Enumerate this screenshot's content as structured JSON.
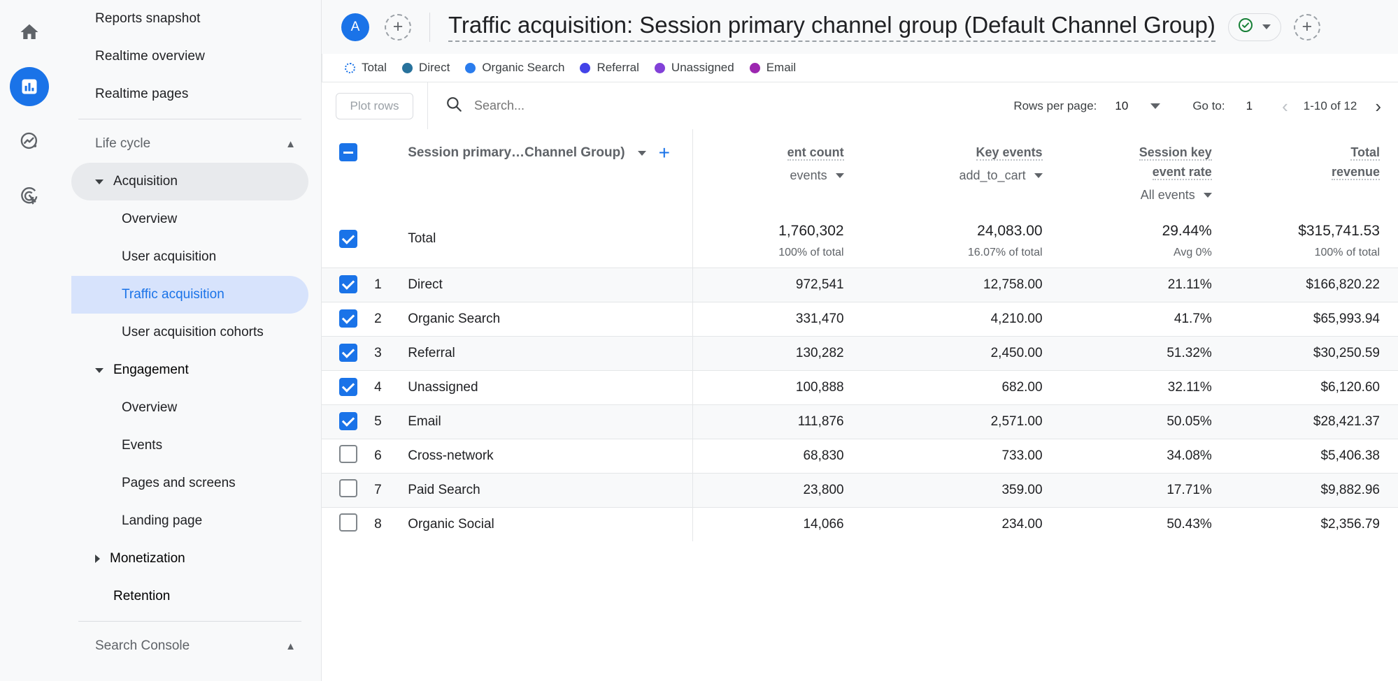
{
  "rail": {
    "items": [
      {
        "name": "home-icon",
        "label": "Home",
        "active": false
      },
      {
        "name": "reports-icon",
        "label": "Reports",
        "active": true
      },
      {
        "name": "explore-icon",
        "label": "Explore",
        "active": false
      },
      {
        "name": "advertising-icon",
        "label": "Advertising",
        "active": false
      }
    ]
  },
  "nav": {
    "top_items": [
      {
        "label": "Reports snapshot"
      },
      {
        "label": "Realtime overview"
      },
      {
        "label": "Realtime pages"
      }
    ],
    "life_cycle": {
      "label": "Life cycle",
      "collapse_icon": "chevron-up-icon"
    },
    "acquisition": {
      "label": "Acquisition",
      "expanded": true,
      "children": [
        {
          "label": "Overview",
          "selected": false
        },
        {
          "label": "User acquisition",
          "selected": false
        },
        {
          "label": "Traffic acquisition",
          "selected": true
        },
        {
          "label": "User acquisition cohorts",
          "selected": false
        }
      ]
    },
    "engagement": {
      "label": "Engagement",
      "expanded": true,
      "children": [
        {
          "label": "Overview"
        },
        {
          "label": "Events"
        },
        {
          "label": "Pages and screens"
        },
        {
          "label": "Landing page"
        }
      ]
    },
    "monetization": {
      "label": "Monetization",
      "expanded": false
    },
    "retention": {
      "label": "Retention"
    },
    "search_console": {
      "label": "Search Console",
      "collapse_icon": "chevron-up-icon"
    }
  },
  "topbar": {
    "avatar_letter": "A",
    "add_comparison_icon": "plus-circle-dashed-icon",
    "title": "Traffic acquisition: Session primary channel group (Default Channel Group)",
    "status_icon": "check-circle-icon",
    "status_color": "#188038",
    "dropdown_icon": "chevron-down-icon",
    "add_icon": "plus-circle-dashed-icon"
  },
  "legend": {
    "items": [
      {
        "label": "Total",
        "color": "#1a73e8",
        "style": "dotted-outline"
      },
      {
        "label": "Direct",
        "color": "#28729c"
      },
      {
        "label": "Organic Search",
        "color": "#2a7ced"
      },
      {
        "label": "Referral",
        "color": "#4343e8"
      },
      {
        "label": "Unassigned",
        "color": "#8241d8"
      },
      {
        "label": "Email",
        "color": "#9c27b0"
      }
    ]
  },
  "toolbar": {
    "plot_rows_label": "Plot rows",
    "search_icon": "search-icon",
    "search_placeholder": "Search...",
    "search_value": "",
    "rows_per_page_label": "Rows per page:",
    "rows_per_page_value": "10",
    "go_to_label": "Go to:",
    "go_to_value": "1",
    "prev_icon": "chevron-left-icon",
    "range_label": "1-10 of 12",
    "next_icon": "chevron-right-icon"
  },
  "table": {
    "header": {
      "select_all_state": "indeterminate",
      "dimension_label": "Session primary…Channel Group)",
      "dimension_dropdown_icon": "chevron-down-icon",
      "add_dimension_icon": "plus-icon",
      "metrics": [
        {
          "title": "Event count",
          "title_clipped": "ent count",
          "sub": "events",
          "sub_clipped": "events",
          "has_dropdown": true,
          "extra": ""
        },
        {
          "title": "Key events",
          "sub": "add_to_cart",
          "has_dropdown": true,
          "extra": ""
        },
        {
          "title_line1": "Session key",
          "title_line2": "event rate",
          "sub": "",
          "extra": "All events",
          "has_dropdown": true
        },
        {
          "title_line1": "Total",
          "title_line2": "revenue",
          "sub": "",
          "extra": "",
          "has_dropdown": false
        }
      ]
    },
    "total_row": {
      "label": "Total",
      "checked": true,
      "values": [
        "1,760,302",
        "24,083.00",
        "29.44%",
        "$315,741.53"
      ],
      "subvalues": [
        "100% of total",
        "16.07% of total",
        "Avg 0%",
        "100% of total"
      ]
    },
    "rows": [
      {
        "index": "1",
        "checked": true,
        "name": "Direct",
        "values": [
          "972,541",
          "12,758.00",
          "21.11%",
          "$166,820.22"
        ]
      },
      {
        "index": "2",
        "checked": true,
        "name": "Organic Search",
        "values": [
          "331,470",
          "4,210.00",
          "41.7%",
          "$65,993.94"
        ]
      },
      {
        "index": "3",
        "checked": true,
        "name": "Referral",
        "values": [
          "130,282",
          "2,450.00",
          "51.32%",
          "$30,250.59"
        ]
      },
      {
        "index": "4",
        "checked": true,
        "name": "Unassigned",
        "values": [
          "100,888",
          "682.00",
          "32.11%",
          "$6,120.60"
        ]
      },
      {
        "index": "5",
        "checked": true,
        "name": "Email",
        "values": [
          "111,876",
          "2,571.00",
          "50.05%",
          "$28,421.37"
        ]
      },
      {
        "index": "6",
        "checked": false,
        "name": "Cross-network",
        "values": [
          "68,830",
          "733.00",
          "34.08%",
          "$5,406.38"
        ]
      },
      {
        "index": "7",
        "checked": false,
        "name": "Paid Search",
        "values": [
          "23,800",
          "359.00",
          "17.71%",
          "$9,882.96"
        ]
      },
      {
        "index": "8",
        "checked": false,
        "name": "Organic Social",
        "values": [
          "14,066",
          "234.00",
          "50.43%",
          "$2,356.79"
        ]
      }
    ]
  }
}
